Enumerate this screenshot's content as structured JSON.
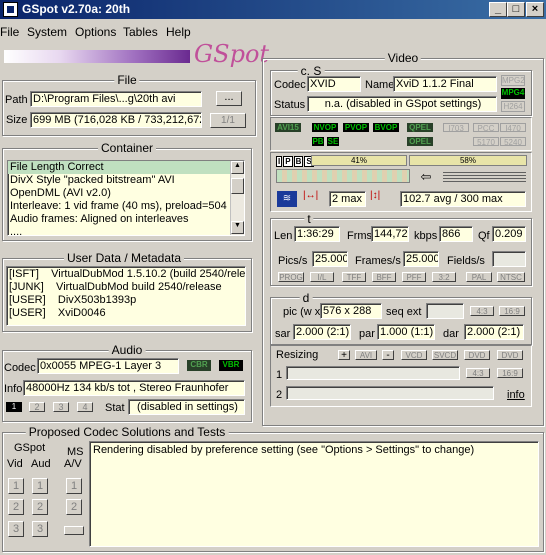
{
  "window": {
    "title": "GSpot v2.70a: 20th",
    "min": "_",
    "max": "□",
    "close": "×"
  },
  "menu": [
    "File",
    "System",
    "Options",
    "Tables",
    "Help"
  ],
  "logo": "GSpot",
  "file": {
    "title": "File",
    "path_label": "Path",
    "path_value": "D:\\Program Files\\...g\\20th avi",
    "browse": "...",
    "size_label": "Size",
    "size_value": "699 MB (716,028 KB / 733,212,672",
    "page": "1/1"
  },
  "container": {
    "title": "Container",
    "lines": [
      "File Length Correct",
      "DivX Style \"packed bitstream\" AVI",
      "OpenDML (AVI v2.0)",
      "Interleave: 1 vid frame (40 ms), preload=504",
      "Audio frames: Aligned on interleaves",
      "...."
    ]
  },
  "userdata": {
    "title": "User Data / Metadata",
    "lines": [
      "[ISFT]    VirtualDubMod 1.5.10.2 (build 2540/rele",
      "[JUNK]    VirtualDubMod build 2540/release",
      "[USER]    DivX503b1393p",
      "[USER]    XviD0046"
    ]
  },
  "audio": {
    "title": "Audio",
    "codec_label": "Codec",
    "codec_value": "0x0055 MPEG-1 Layer 3",
    "cbr": "CBR",
    "vbr": "VBR",
    "info_label": "Info",
    "info_value": "48000Hz  134 kb/s tot , Stereo Fraunhofer",
    "tracks": [
      "1",
      "2",
      "3",
      "4"
    ],
    "stat_label": "Stat",
    "stat_value": "(disabled in settings)"
  },
  "proposed": {
    "title": "Proposed Codec Solutions and Tests",
    "gspot_label": "GSpot",
    "vid_label": "Vid",
    "aud_label": "Aud",
    "ms_label": "MS",
    "av_label": "A/V",
    "message": "Rendering disabled by preference setting (see \"Options > Settings\" to change)",
    "nums": [
      "1",
      "2",
      "3"
    ]
  },
  "video": {
    "title": "Video",
    "cs_title": "c. S",
    "codec_label": "Codec",
    "codec_value": "XVID",
    "name_label": "Name",
    "name_value": "XviD 1.1.2 Final",
    "status_label": "Status",
    "status_value": "n.a. (disabled in GSpot settings)",
    "badges_right": [
      "MPG2",
      "MPG4",
      "H264"
    ],
    "flags": [
      "AVI15",
      "NVOP",
      "PVOP",
      "BVOP",
      "QPEL",
      "GMC",
      "PB",
      "SE",
      "OPEL",
      "I703",
      "PCC",
      "I470",
      "5170",
      "5240"
    ],
    "ipbs": [
      "I",
      "P",
      "B",
      "S"
    ],
    "pct1": "41%",
    "pct2": "58%",
    "bframes": "2 max",
    "avg": "102.7 avg / 300 max",
    "t_title": "t",
    "len_label": "Len",
    "len_value": "1:36:29",
    "frms_label": "Frms",
    "frms_value": "144,72",
    "kbps_label": "kbps",
    "kbps_value": "866",
    "qf_label": "Qf",
    "qf_value": "0.209",
    "pics_label": "Pics/s",
    "pics_value": "25.000",
    "frames_label": "Frames/s",
    "frames_value": "25.000",
    "fields_label": "Fields/s",
    "fields_value": "",
    "tbtns": [
      "PROG",
      "I/L",
      "TFF",
      "BFF",
      "PFF",
      "3:2",
      "PAL",
      "NTSC"
    ],
    "d_title": "d",
    "pic_label": "pic (w x",
    "pic_value": "576 x 288",
    "seqext_label": "seq ext",
    "seqext_value": "",
    "r43": "4:3",
    "r169": "16:9",
    "sar_label": "sar",
    "sar_value": "2.000 (2:1)",
    "par_label": "par",
    "par_value": "1.000 (1:1)",
    "dar_label": "dar",
    "dar_value": "2.000 (2:1)",
    "resizing_label": "Resizing",
    "resize_btns": [
      "+",
      "AVI",
      "-",
      "VCD",
      "SVCD",
      "DVD",
      "DVD"
    ],
    "row1": "1",
    "row2": "2",
    "info": "info"
  }
}
